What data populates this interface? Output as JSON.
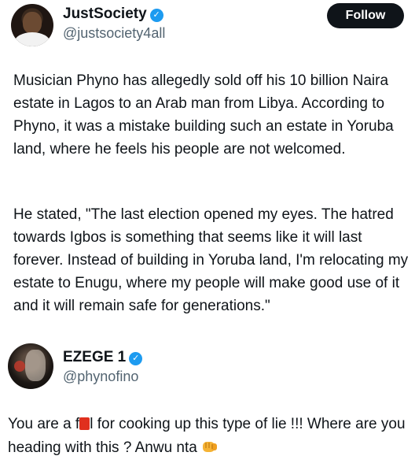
{
  "tweet": {
    "author": {
      "name": "JustSociety",
      "handle": "@justsociety4all",
      "verified_icon": "check-badge-icon"
    },
    "follow_label": "Follow",
    "paragraphs": [
      "Musician Phyno has allegedly sold off his 10 billion Naira estate in Lagos to an Arab man from Libya. According to Phyno, it was a mistake building such an estate in Yoruba land, where he feels his people are not welcomed.",
      "He stated, \"The last election opened my eyes. The hatred towards Igbos is something that seems like it will last forever. Instead of building in Yoruba land, I'm relocating my estate to Enugu, where my people will make good use of it and it will remain safe for generations.\""
    ]
  },
  "reply": {
    "author": {
      "name": "EZEGE 1",
      "handle": "@phynofino",
      "verified_icon": "check-badge-icon"
    },
    "text_before_censor": "You are a f",
    "text_after_censor": "l for cooking up this type of lie !!! Where are you heading with this ? Anwu nta",
    "censor_color": "#e0301e",
    "emoji_icon": "fist-bump-icon"
  },
  "colors": {
    "verified": "#1d9bf0",
    "follow_button": "#0f1419",
    "handle_text": "#536471"
  }
}
